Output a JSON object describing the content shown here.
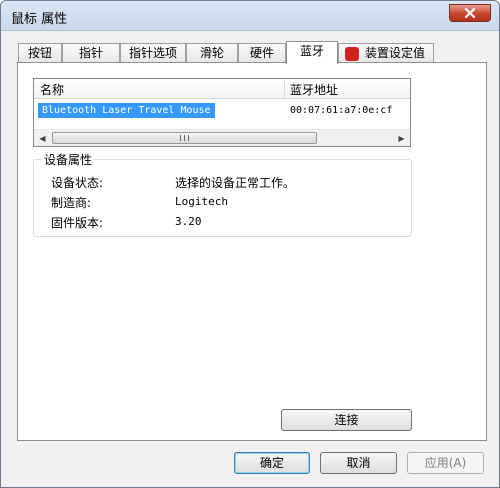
{
  "window": {
    "title": "鼠标 属性"
  },
  "icons": {
    "close": "close-x-icon",
    "tab_badge": "logitech-logo-icon"
  },
  "tabs": [
    {
      "label": "按钮"
    },
    {
      "label": "指针"
    },
    {
      "label": "指针选项"
    },
    {
      "label": "滑轮"
    },
    {
      "label": "硬件"
    },
    {
      "label": "蓝牙"
    },
    {
      "label": "装置设定值"
    }
  ],
  "active_tab": "蓝牙",
  "device_list": {
    "columns": {
      "name": "名称",
      "address": "蓝牙地址"
    },
    "rows": [
      {
        "name": "Bluetooth Laser Travel Mouse",
        "address": "00:07:61:a7:0e:cf"
      }
    ]
  },
  "properties": {
    "group_title": "设备属性",
    "items": [
      {
        "label": "设备状态:",
        "value": "选择的设备正常工作。"
      },
      {
        "label": "制造商:",
        "value": "Logitech"
      },
      {
        "label": "固件版本:",
        "value": "3.20"
      }
    ]
  },
  "buttons": {
    "connect": "连接",
    "ok": "确定",
    "cancel": "取消",
    "apply": "应用(A)"
  },
  "colors": {
    "selection": "#3399ff",
    "close_button": "#c7442e"
  }
}
